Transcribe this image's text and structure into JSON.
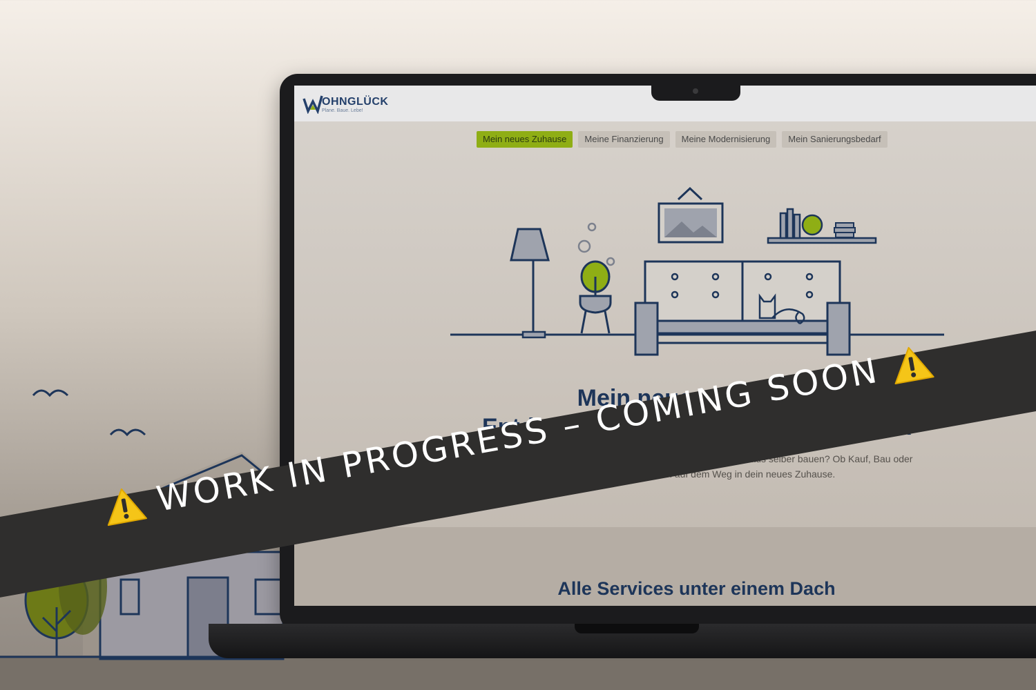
{
  "site": {
    "logo_name": "OHNGLÜCK",
    "logo_tagline": "Plane. Baue. Lebe!",
    "brand_colors": {
      "navy": "#1d3559",
      "green": "#8fae15"
    }
  },
  "nav": {
    "tabs": [
      {
        "label": "Mein neues Zuhause",
        "active": true
      },
      {
        "label": "Meine Finanzierung",
        "active": false
      },
      {
        "label": "Meine Modernisierung",
        "active": false
      },
      {
        "label": "Mein Sanierungsbedarf",
        "active": false
      }
    ]
  },
  "hero": {
    "title_line1": "Mein neues Zuhause:",
    "title_line2": "Entdecke die Services von Wohnglück",
    "text_line1": "Suchst du nach einem Eigenheim oder willst du dein Traumhaus selber bauen? Ob Kauf, Bau oder",
    "text_line2": "Miete, wir begleiten dich auf dem Weg in dein neues Zuhause."
  },
  "services": {
    "title": "Alle Services unter einem Dach"
  },
  "banner": {
    "text": "WORK IN PROGRESS – COMING SOON",
    "icon": "warning-icon",
    "icon_color": "#f5c518"
  }
}
